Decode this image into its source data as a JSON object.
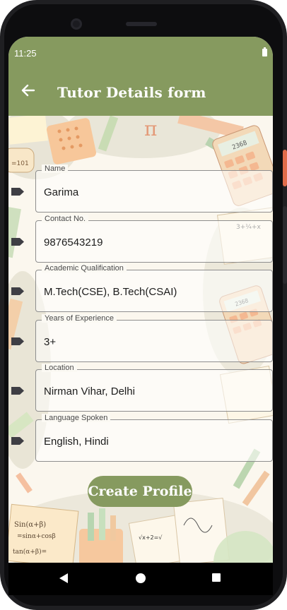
{
  "status_bar": {
    "time": "11:25"
  },
  "app_bar": {
    "title": "Tutor Details form"
  },
  "form": {
    "fields": [
      {
        "label": "Name",
        "value": "Garima"
      },
      {
        "label": "Contact No.",
        "value": "9876543219"
      },
      {
        "label": "Academic Qualification",
        "value": "M.Tech(CSE), B.Tech(CSAI)"
      },
      {
        "label": "Years of Experience",
        "value": "3+"
      },
      {
        "label": "Location",
        "value": "Nirman Vihar, Delhi"
      },
      {
        "label": "Language Spoken",
        "value": "English, Hindi"
      }
    ],
    "submit_label": "Create Profile"
  },
  "colors": {
    "accent": "#869a5f",
    "background": "#fbf7ee"
  },
  "icons": {
    "back": "arrow-left-icon",
    "field": "label-tag-icon"
  }
}
